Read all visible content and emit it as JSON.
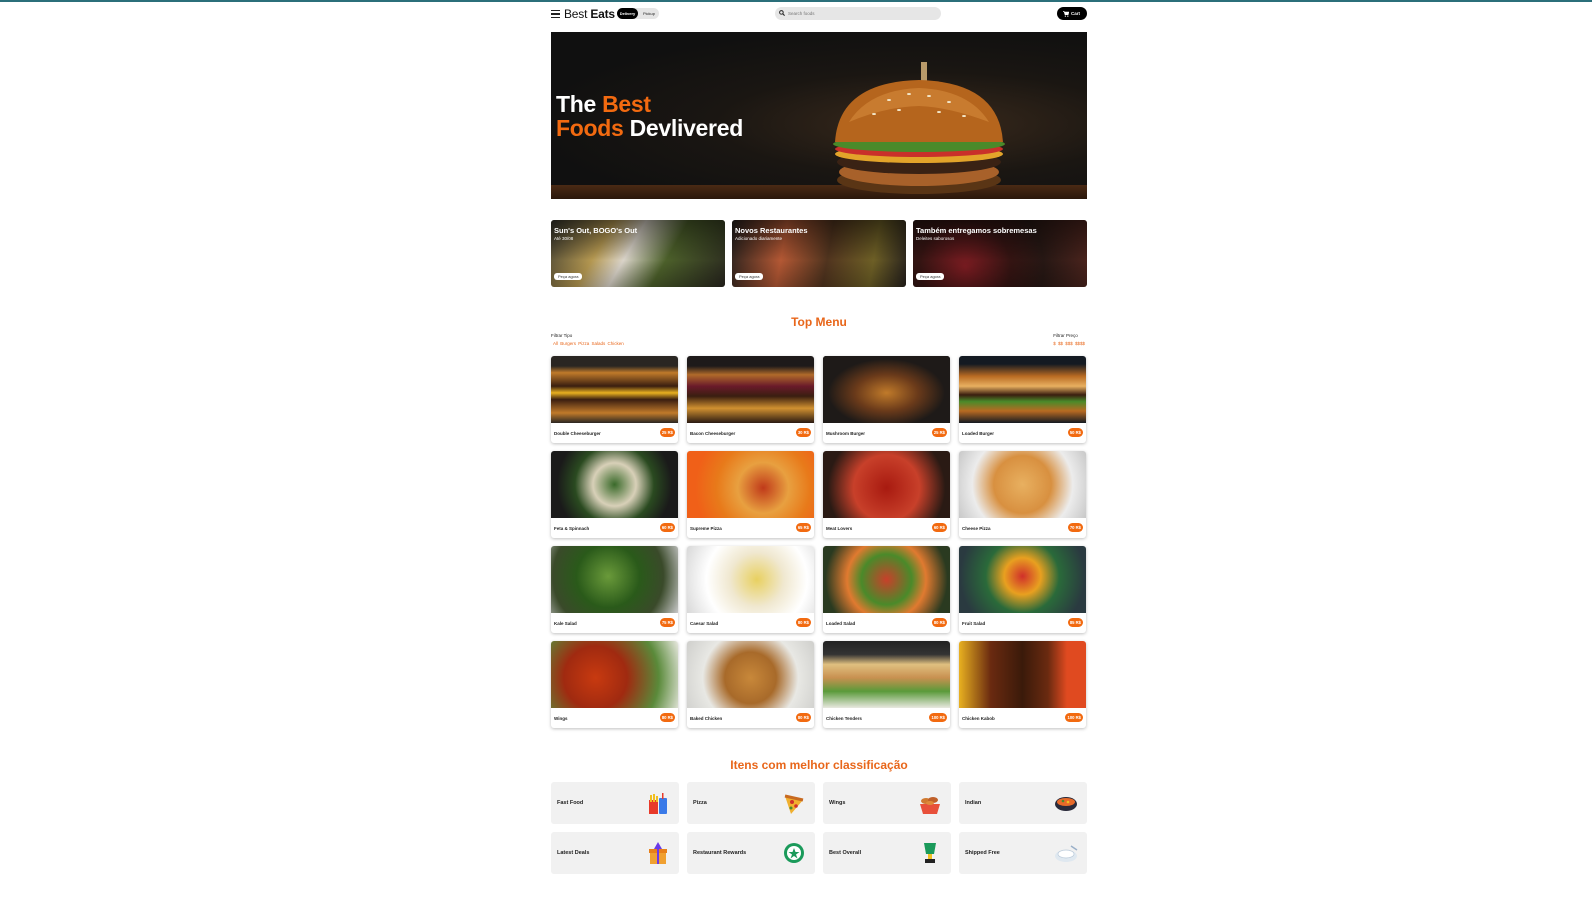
{
  "header": {
    "logo_light": "Best",
    "logo_bold": "Eats",
    "toggle_on": "Delivery",
    "toggle_off": "Pickup",
    "search_placeholder": "Search foods",
    "cart_label": "Cart"
  },
  "hero": {
    "line1_white": "The",
    "line1_orange": "Best",
    "line2_orange": "Foods",
    "line2_white": "Devlivered"
  },
  "promos": [
    {
      "title": "Sun's Out, BOGO's Out",
      "subtitle": "Até 30/08",
      "button": "Peça agora"
    },
    {
      "title": "Novos Restaurantes",
      "subtitle": "Adicionado diariamente",
      "button": "Peça agora"
    },
    {
      "title": "Também entregamos sobremesas",
      "subtitle": "Deleites saborosos",
      "button": "Peça agora"
    }
  ],
  "top_menu": {
    "title": "Top Menu",
    "filter_type_label": "Filtrar Tipo",
    "filter_type_options": "All Burgers Pizza Salads Chicken",
    "filter_price_label": "Filtrar Preço",
    "filter_price_options": "$ $$ $$$ $$$$",
    "items": [
      {
        "name": "Double Cheeseburger",
        "price": "25 R$"
      },
      {
        "name": "Bacon Cheeseburger",
        "price": "30 R$"
      },
      {
        "name": "Mushroom Burger",
        "price": "25 R$"
      },
      {
        "name": "Loaded Burger",
        "price": "50 R$"
      },
      {
        "name": "Feta & Spinnach",
        "price": "60 R$"
      },
      {
        "name": "Supreme Pizza",
        "price": "65 R$"
      },
      {
        "name": "Meat Lovers",
        "price": "60 R$"
      },
      {
        "name": "Cheese Pizza",
        "price": "70 R$"
      },
      {
        "name": "Kale Salad",
        "price": "75 R$"
      },
      {
        "name": "Caesar Salad",
        "price": "80 R$"
      },
      {
        "name": "Loaded Salad",
        "price": "80 R$"
      },
      {
        "name": "Fruit Salad",
        "price": "85 R$"
      },
      {
        "name": "Wings",
        "price": "80 R$"
      },
      {
        "name": "Baked Chicken",
        "price": "80 R$"
      },
      {
        "name": "Chicken Tenders",
        "price": "100 R$"
      },
      {
        "name": "Chicken Kabob",
        "price": "100 R$"
      }
    ]
  },
  "categories": {
    "title": "Itens com melhor classificação",
    "items": [
      {
        "name": "Fast Food",
        "icon": "fries-soda-icon"
      },
      {
        "name": "Pizza",
        "icon": "pizza-icon"
      },
      {
        "name": "Wings",
        "icon": "wings-box-icon"
      },
      {
        "name": "Indian",
        "icon": "curry-bowl-icon"
      },
      {
        "name": "Latest Deals",
        "icon": "gift-box-icon"
      },
      {
        "name": "Restaurant Rewards",
        "icon": "reward-coin-icon"
      },
      {
        "name": "Best Overall",
        "icon": "trophy-icon"
      },
      {
        "name": "Shipped Free",
        "icon": "plate-icon"
      }
    ]
  },
  "colors": {
    "accent": "#f26a10",
    "title": "#e8661a"
  }
}
